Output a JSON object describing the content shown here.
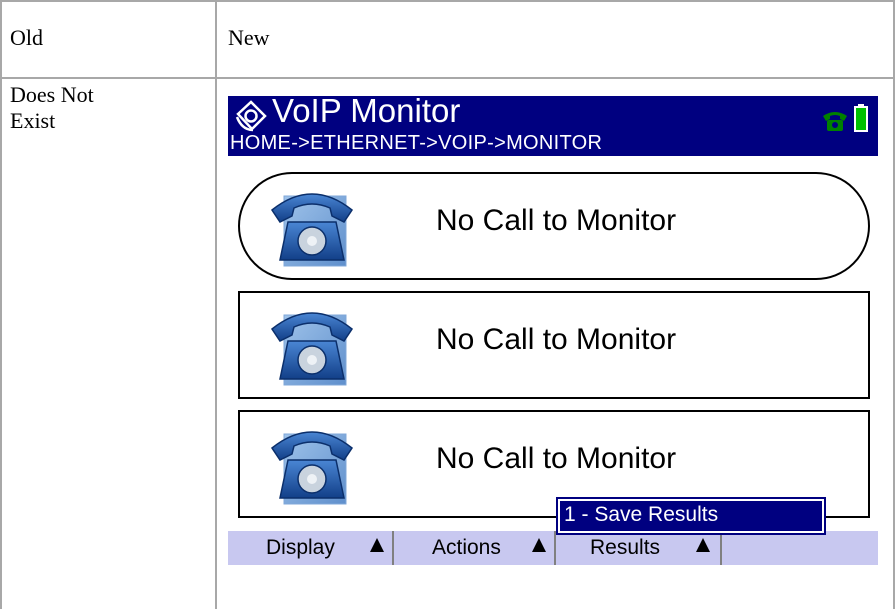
{
  "table": {
    "header_old": "Old",
    "header_new": "New",
    "old_cell": "Does Not\nExist"
  },
  "device": {
    "title": "VoIP Monitor",
    "breadcrumb": "HOME->ETHERNET->VOIP->MONITOR",
    "status_icons": [
      "phone-icon",
      "battery-icon"
    ],
    "colors": {
      "titlebar": "#000080",
      "softkey_bar": "#c8c8f0",
      "phone_status": "#008000",
      "battery": "#00c000"
    },
    "calls": [
      {
        "label": "No Call to Monitor",
        "selected": true
      },
      {
        "label": "No Call to Monitor",
        "selected": false
      },
      {
        "label": "No Call to Monitor",
        "selected": false
      }
    ],
    "softkeys": [
      {
        "label": "Display"
      },
      {
        "label": "Actions"
      },
      {
        "label": "Results"
      }
    ],
    "popup_menu": {
      "items": [
        "1 - Save Results"
      ]
    }
  }
}
